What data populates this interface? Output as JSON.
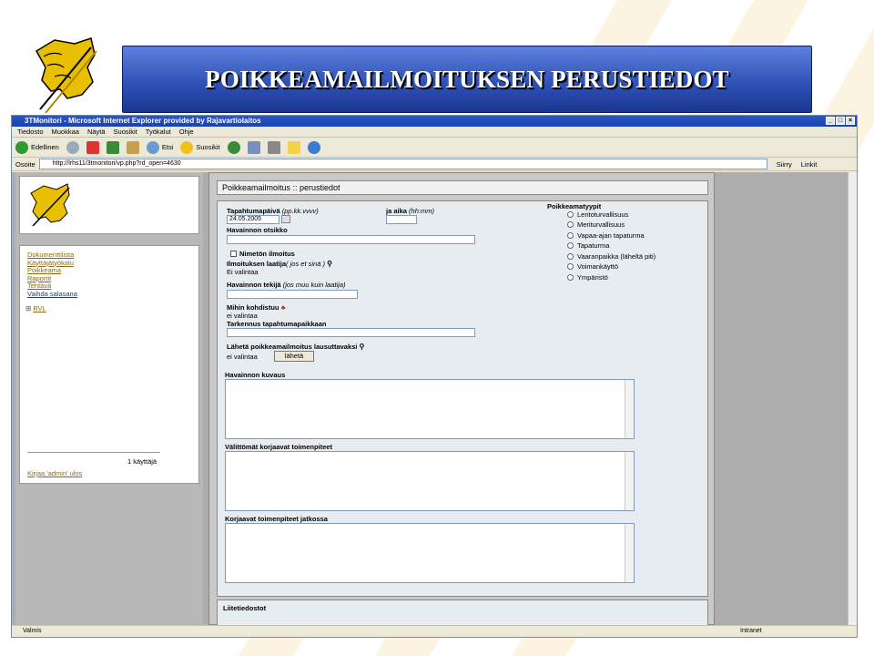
{
  "slide": {
    "title": "POIKKEAMAILMOITUKSEN PERUSTIEDOT"
  },
  "browser": {
    "window_title": "3TMonitori - Microsoft Internet Explorer provided by Rajavartiolaitos",
    "menu": [
      "Tiedosto",
      "Muokkaa",
      "Näytä",
      "Suosikit",
      "Työkalut",
      "Ohje"
    ],
    "toolbar": {
      "back": "Edellinen",
      "search": "Etsi",
      "favorites": "Suosikit"
    },
    "address_label": "Osoite",
    "address_value": "http://lrhs11/3tmonitori/vp.php?rd_open=4630",
    "go_label": "Siirry",
    "links_label": "Linkit",
    "status_left": "Valmis",
    "status_zone": "Intranet"
  },
  "left_nav": {
    "links": [
      "Dokumenttilista",
      "Käyttäjätyökalu",
      "Poikkeama",
      "Raportit",
      "Tehtävä",
      "Vaihda salasana"
    ],
    "tree_item": "RVL",
    "users_count": "1 käyttäjä",
    "logout": "Kirjaa 'admin' ulos"
  },
  "form": {
    "header": "Poikkeamailmoitus :: perustiedot",
    "date_label": "Tapahtumapäivä",
    "date_hint": "(pp.kk.vvvv)",
    "date_value": "24.05.2005",
    "time_label": "ja aika",
    "time_hint": "(hh:mm)",
    "time_value": "",
    "subject_label": "Havainnon otsikko",
    "anonymous_label": "Nimetön ilmoitus",
    "reporter_label": "Ilmoituksen laatija",
    "reporter_hint": "( jos et sinä )",
    "reporter_value": "Ei valintaa",
    "observer_label": "Havainnon tekijä",
    "observer_hint": "(jos muu kuin laatija)",
    "target_label": "Mihin kohdistuu",
    "target_value": "ei valintaa",
    "location_label": "Tarkennus tapahtumapaikkaan",
    "send_label": "Lähetä poikkeamailmoitus lausuttavaksi",
    "send_value": "ei valintaa",
    "send_button": "lähetä",
    "description_label": "Havainnon kuvaus",
    "immediate_label": "Välittömät korjaavat toimenpiteet",
    "followup_label": "Korjaavat toimenpiteet jatkossa",
    "attachments_label": "Liitetiedostot",
    "types_label": "Poikkeamatyypit",
    "types": [
      "Lentoturvallisuus",
      "Meriturvallisuus",
      "Vapaa-ajan tapaturma",
      "Tapaturma",
      "Vaaranpaikka (läheltä piti)",
      "Voimankäyttö",
      "Ympäristö"
    ]
  },
  "colors": {
    "banner": "#2d4fb4",
    "link": "#8a6b12",
    "form_bg": "#e7ecf1"
  }
}
